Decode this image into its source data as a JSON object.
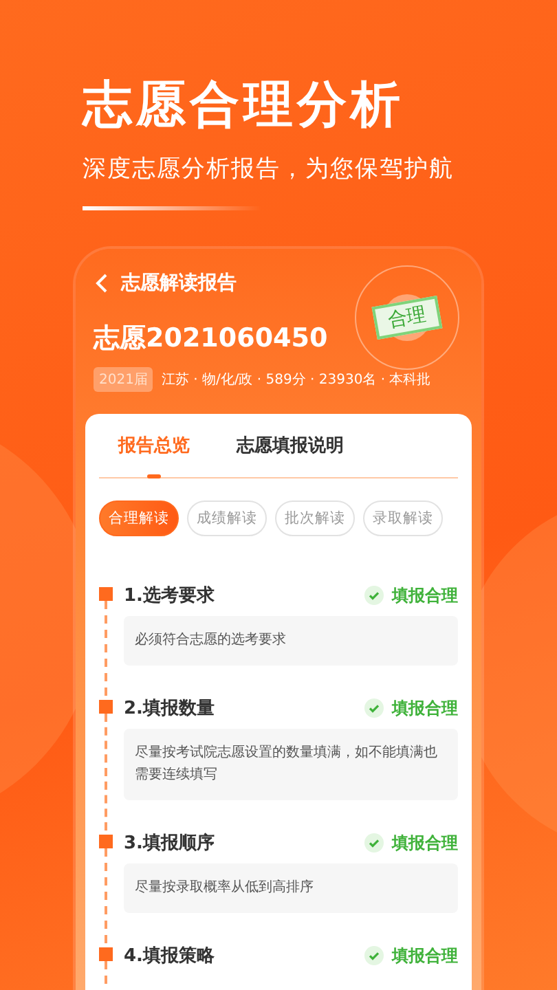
{
  "headline": "志愿合理分析",
  "subtitle": "深度志愿分析报告，为您保驾护航",
  "report": {
    "title": "志愿解读报告",
    "stamp": "合理",
    "name": "志愿2021060450",
    "year_badge": "2021届",
    "meta": "江苏 · 物/化/政 · 589分 · 23930名 · 本科批"
  },
  "tabs": [
    {
      "label": "报告总览",
      "selected": true
    },
    {
      "label": "志愿填报说明",
      "selected": false
    }
  ],
  "chips": [
    {
      "label": "合理解读",
      "selected": true
    },
    {
      "label": "成绩解读",
      "selected": false
    },
    {
      "label": "批次解读",
      "selected": false
    },
    {
      "label": "录取解读",
      "selected": false
    }
  ],
  "items": [
    {
      "title": "1.选考要求",
      "status": "填报合理",
      "desc": "必须符合志愿的选考要求"
    },
    {
      "title": "2.填报数量",
      "status": "填报合理",
      "desc": "尽量按考试院志愿设置的数量填满，如不能填满也需要连续填写"
    },
    {
      "title": "3.填报顺序",
      "status": "填报合理",
      "desc": "尽量按录取概率从低到高排序"
    },
    {
      "title": "4.填报策略",
      "status": "填报合理"
    }
  ]
}
